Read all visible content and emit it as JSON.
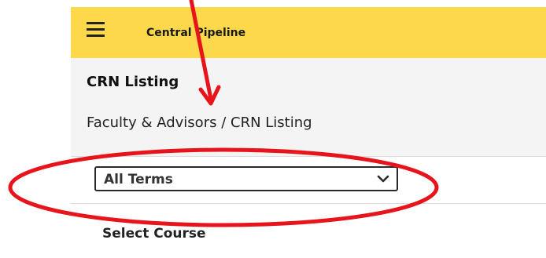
{
  "header": {
    "app_title": "Central Pipeline",
    "menu_icon": "hamburger-menu-icon",
    "background_color": "#fcd84a"
  },
  "page": {
    "title": "CRN Listing",
    "breadcrumb": {
      "parent": "Faculty & Advisors",
      "separator": " / ",
      "current": "CRN Listing"
    }
  },
  "filters": {
    "term_select": {
      "selected": "All Terms",
      "icon": "chevron-down-icon"
    },
    "course_label": "Select Course"
  },
  "annotation": {
    "color": "#e8141c"
  }
}
